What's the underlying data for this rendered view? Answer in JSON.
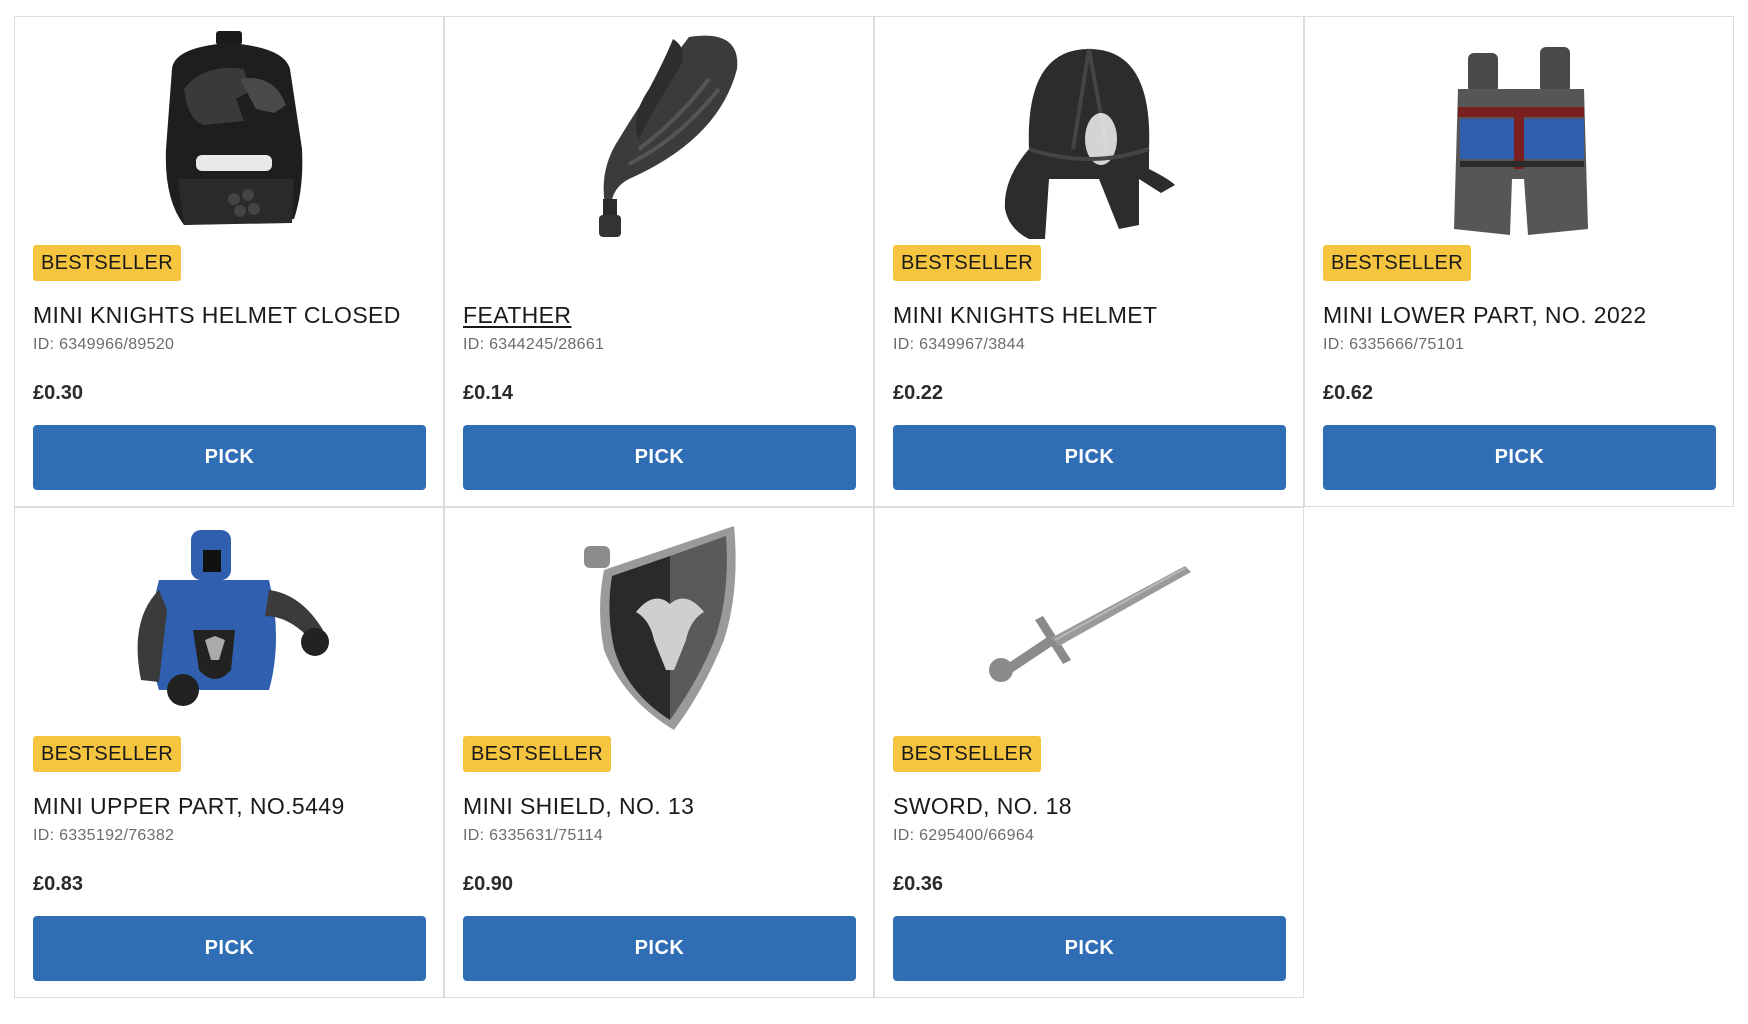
{
  "products": [
    {
      "badge": "BESTSELLER",
      "title": "MINI KNIGHTS HELMET CLOSED",
      "id": "ID: 6349966/89520",
      "price": "£0.30",
      "button": "PICK",
      "icon": "closed-knight-helmet-icon"
    },
    {
      "badge": "",
      "title": "FEATHER",
      "id": "ID: 6344245/28661",
      "price": "£0.14",
      "button": "PICK",
      "icon": "feather-plume-icon"
    },
    {
      "badge": "BESTSELLER",
      "title": "MINI KNIGHTS HELMET",
      "id": "ID: 6349967/3844",
      "price": "£0.22",
      "button": "PICK",
      "icon": "knight-helmet-icon"
    },
    {
      "badge": "BESTSELLER",
      "title": "MINI LOWER PART, NO. 2022",
      "id": "ID: 6335666/75101",
      "price": "£0.62",
      "button": "PICK",
      "icon": "minifig-legs-icon"
    },
    {
      "badge": "BESTSELLER",
      "title": "MINI UPPER PART, NO.5449",
      "id": "ID: 6335192/76382",
      "price": "£0.83",
      "button": "PICK",
      "icon": "minifig-torso-icon"
    },
    {
      "badge": "BESTSELLER",
      "title": "MINI SHIELD, NO. 13",
      "id": "ID: 6335631/75114",
      "price": "£0.90",
      "button": "PICK",
      "icon": "eagle-shield-icon"
    },
    {
      "badge": "BESTSELLER",
      "title": "SWORD, NO. 18",
      "id": "ID: 6295400/66964",
      "price": "£0.36",
      "button": "PICK",
      "icon": "sword-icon"
    }
  ],
  "colors": {
    "badge": "#f5c53f",
    "button": "#2f6db5"
  }
}
